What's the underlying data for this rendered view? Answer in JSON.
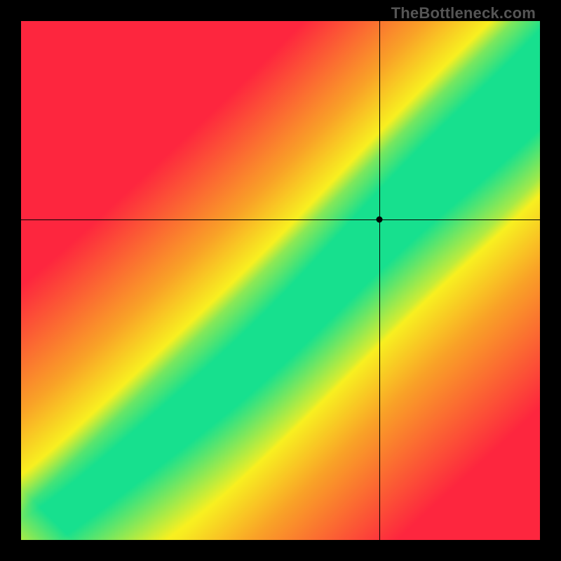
{
  "watermark": "TheBottleneck.com",
  "chart_data": {
    "type": "heatmap",
    "title": "",
    "xlabel": "",
    "ylabel": "",
    "xlim": [
      0,
      1
    ],
    "ylim": [
      0,
      1
    ],
    "grid": false,
    "legend": false,
    "crosshair": {
      "x": 0.691,
      "y": 0.617
    },
    "marker": {
      "x": 0.691,
      "y": 0.617
    },
    "band": {
      "comment": "Green diagonal band: center line y = a*x^p, band_half_width in y-units, color ramps green->yellow->red with distance.",
      "a": 0.9,
      "p": 1.15,
      "half_width_low": 0.04,
      "half_width_high": 0.095,
      "yellow_falloff": 0.11,
      "osc_amp": 0.012,
      "osc_freq": 11.0
    },
    "colors": {
      "green": "#17e08e",
      "yellow": "#f8f020",
      "red": "#fd263e",
      "orange": "#f9a327"
    },
    "resolution": 160
  }
}
